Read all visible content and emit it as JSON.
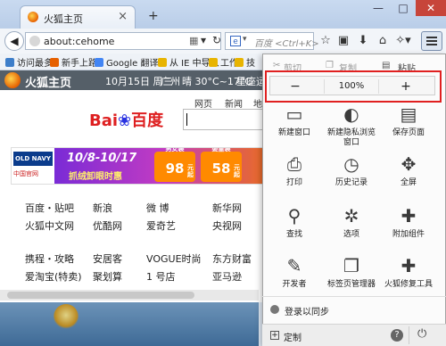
{
  "window": {
    "tab_title": "火狐主页",
    "tab_close": "×",
    "new_tab": "+",
    "minimize": "—",
    "maximize": "□",
    "close": "✕"
  },
  "navbar": {
    "back": "◀",
    "url": "about:cehome",
    "search_engine_icon": "e",
    "search_placeholder": "百度 <Ctrl+K>",
    "icons": [
      "bookmark-star-icon",
      "clipboard-icon",
      "download-icon",
      "home-icon"
    ]
  },
  "bookmarks": [
    {
      "label": "访问最多",
      "color": "#3d7ec9"
    },
    {
      "label": "新手上路",
      "color": "#e66000"
    },
    {
      "label": "Google 翻译",
      "color": "#4285f4"
    },
    {
      "label": "从 IE 中导入",
      "color": "#e8b400"
    },
    {
      "label": "工作",
      "color": "#e8b400"
    },
    {
      "label": "技",
      "color": "#e8b400"
    }
  ],
  "page": {
    "header": {
      "title": "火狐主页",
      "date": "10月15日 周三",
      "city": "广州",
      "weather": "晴 30°C~17°C",
      "constellation": "星座运"
    },
    "baidu_tabs": [
      "网页",
      "新闻",
      "地"
    ],
    "baidu_logo_a": "Bai",
    "baidu_logo_b": "du",
    "baidu_logo_c": "百度",
    "banner": {
      "brand": "OLD NAVY",
      "brand_sub": "中国官网",
      "dates": "10/8-10/17",
      "slogan": "抓绒卸眼时惠",
      "price1_label": "男女装",
      "price1": "98",
      "price2_label": "婴童装",
      "price2": "58",
      "unit": "元起"
    },
    "links": [
      [
        "百度・贴吧",
        "新浪",
        "微  博",
        "新华网"
      ],
      [
        "火狐中文网",
        "优酷网",
        "爱奇艺",
        "央视网"
      ],
      [
        "携程・攻略",
        "安居客",
        "VOGUE时尚",
        "东方财富"
      ],
      [
        "爱淘宝(特卖)",
        "聚划算",
        "1 号店",
        "亚马逊"
      ]
    ]
  },
  "menu": {
    "cut": "剪切",
    "copy": "复制",
    "paste": "粘贴",
    "zoom_out": "−",
    "zoom_level": "100%",
    "zoom_in": "+",
    "items": [
      {
        "label": "新建窗口",
        "icon": "new-window-icon",
        "glyph": "▭"
      },
      {
        "label": "新建隐私浏览窗口",
        "icon": "private-mask-icon",
        "glyph": "◐"
      },
      {
        "label": "保存页面",
        "icon": "save-page-icon",
        "glyph": "▤"
      },
      {
        "label": "打印",
        "icon": "print-icon",
        "glyph": "⎙"
      },
      {
        "label": "历史记录",
        "icon": "history-clock-icon",
        "glyph": "◷"
      },
      {
        "label": "全屏",
        "icon": "fullscreen-icon",
        "glyph": "✥"
      },
      {
        "label": "查找",
        "icon": "magnifier-icon",
        "glyph": "⚲"
      },
      {
        "label": "选项",
        "icon": "gear-icon",
        "glyph": "✲"
      },
      {
        "label": "附加组件",
        "icon": "puzzle-icon",
        "glyph": "✚"
      },
      {
        "label": "开发者",
        "icon": "wrench-icon",
        "glyph": "✎"
      },
      {
        "label": "标签页管理器",
        "icon": "tab-manager-icon",
        "glyph": "❐"
      },
      {
        "label": "火狐修复工具",
        "icon": "repair-kit-icon",
        "glyph": "✚"
      }
    ],
    "sync": "登录以同步",
    "customize": "定制",
    "help": "?",
    "quit": "⏻"
  }
}
